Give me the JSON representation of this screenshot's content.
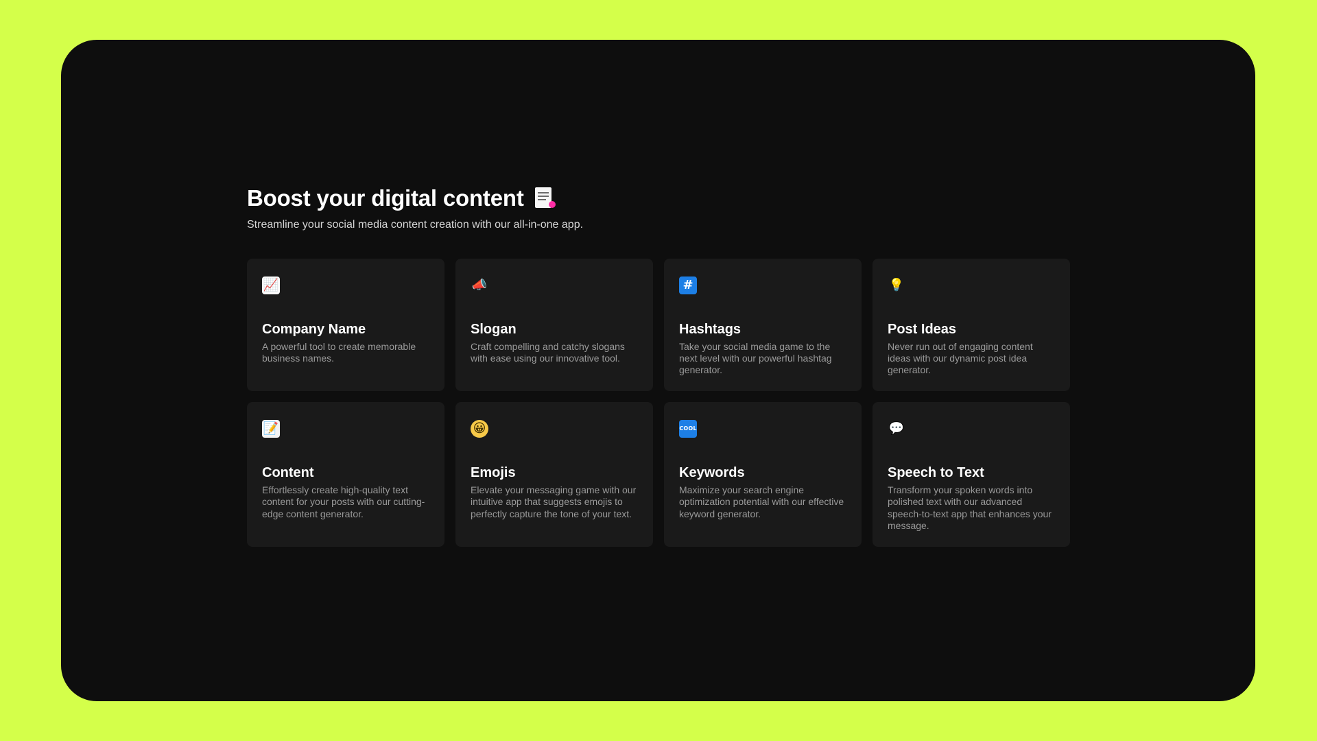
{
  "hero": {
    "title": "Boost your digital content",
    "title_icon": "document-icon",
    "subtitle": "Streamline your social media content creation with our all-in-one app."
  },
  "colors": {
    "background": "#d4ff4a",
    "frame": "#0e0e0e",
    "card": "#1a1a1a",
    "title": "#ffffff",
    "description": "#9a9a9a"
  },
  "cards": [
    {
      "icon": "chart-increasing-icon",
      "glyph": "📈",
      "title": "Company Name",
      "description": "A powerful tool to create memorable business names."
    },
    {
      "icon": "megaphone-icon",
      "glyph": "📣",
      "title": "Slogan",
      "description": "Craft compelling and catchy slogans with ease using our innovative tool."
    },
    {
      "icon": "hashtag-icon",
      "glyph": "#",
      "title": "Hashtags",
      "description": "Take your social media game to the next level with our powerful hashtag generator."
    },
    {
      "icon": "light-bulb-icon",
      "glyph": "💡",
      "title": "Post Ideas",
      "description": "Never run out of engaging content ideas with our dynamic post idea generator."
    },
    {
      "icon": "memo-icon",
      "glyph": "📝",
      "title": "Content",
      "description": "Effortlessly create high-quality text content for your posts with our cutting-edge content generator."
    },
    {
      "icon": "grinning-face-icon",
      "glyph": "😀",
      "title": "Emojis",
      "description": "Elevate your messaging game with our intuitive app that suggests emojis to perfectly capture the tone of your text."
    },
    {
      "icon": "cool-button-icon",
      "glyph": "COOL",
      "title": "Keywords",
      "description": "Maximize your search engine optimization potential with our effective keyword generator."
    },
    {
      "icon": "speech-balloon-icon",
      "glyph": "💬",
      "title": "Speech to Text",
      "description": "Transform your spoken words into polished text with our advanced speech-to-text app that enhances your message."
    }
  ]
}
